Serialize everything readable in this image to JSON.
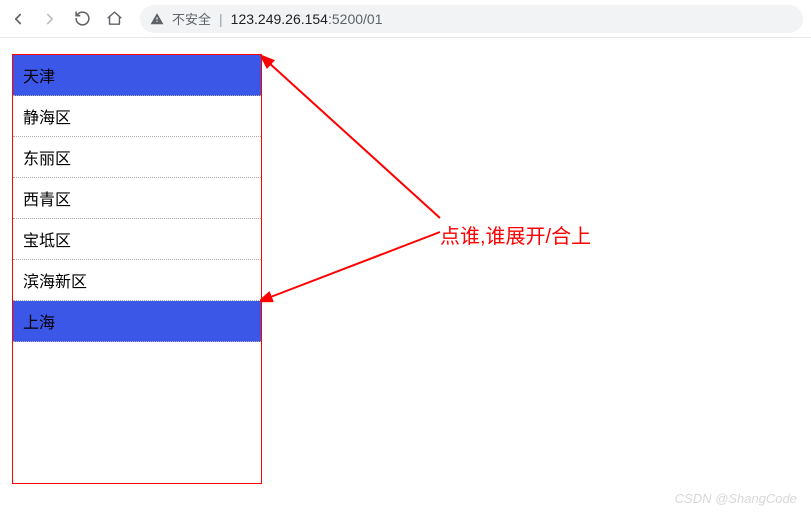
{
  "toolbar": {
    "insecure_label": "不安全",
    "url_host": "123.249.26.154",
    "url_port_path": ":5200/01"
  },
  "accordion": {
    "groups": [
      {
        "header": "天津",
        "expanded": true,
        "items": [
          "静海区",
          "东丽区",
          "西青区",
          "宝坻区",
          "滨海新区"
        ]
      },
      {
        "header": "上海",
        "expanded": false,
        "items": []
      }
    ]
  },
  "annotation": {
    "text": "点谁,谁展开/合上"
  },
  "watermark": "CSDN @ShangCode"
}
